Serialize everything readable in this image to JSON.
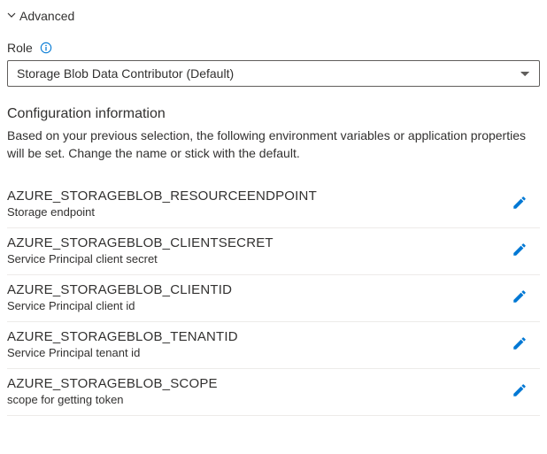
{
  "advanced": {
    "label": "Advanced"
  },
  "role": {
    "label": "Role",
    "selected": "Storage Blob Data Contributor (Default)"
  },
  "config": {
    "heading": "Configuration information",
    "description": "Based on your previous selection, the following environment variables or application properties will be set. Change the name or stick with the default.",
    "items": [
      {
        "name": "AZURE_STORAGEBLOB_RESOURCEENDPOINT",
        "desc": "Storage endpoint"
      },
      {
        "name": "AZURE_STORAGEBLOB_CLIENTSECRET",
        "desc": "Service Principal client secret"
      },
      {
        "name": "AZURE_STORAGEBLOB_CLIENTID",
        "desc": "Service Principal client id"
      },
      {
        "name": "AZURE_STORAGEBLOB_TENANTID",
        "desc": "Service Principal tenant id"
      },
      {
        "name": "AZURE_STORAGEBLOB_SCOPE",
        "desc": "scope for getting token"
      }
    ]
  }
}
